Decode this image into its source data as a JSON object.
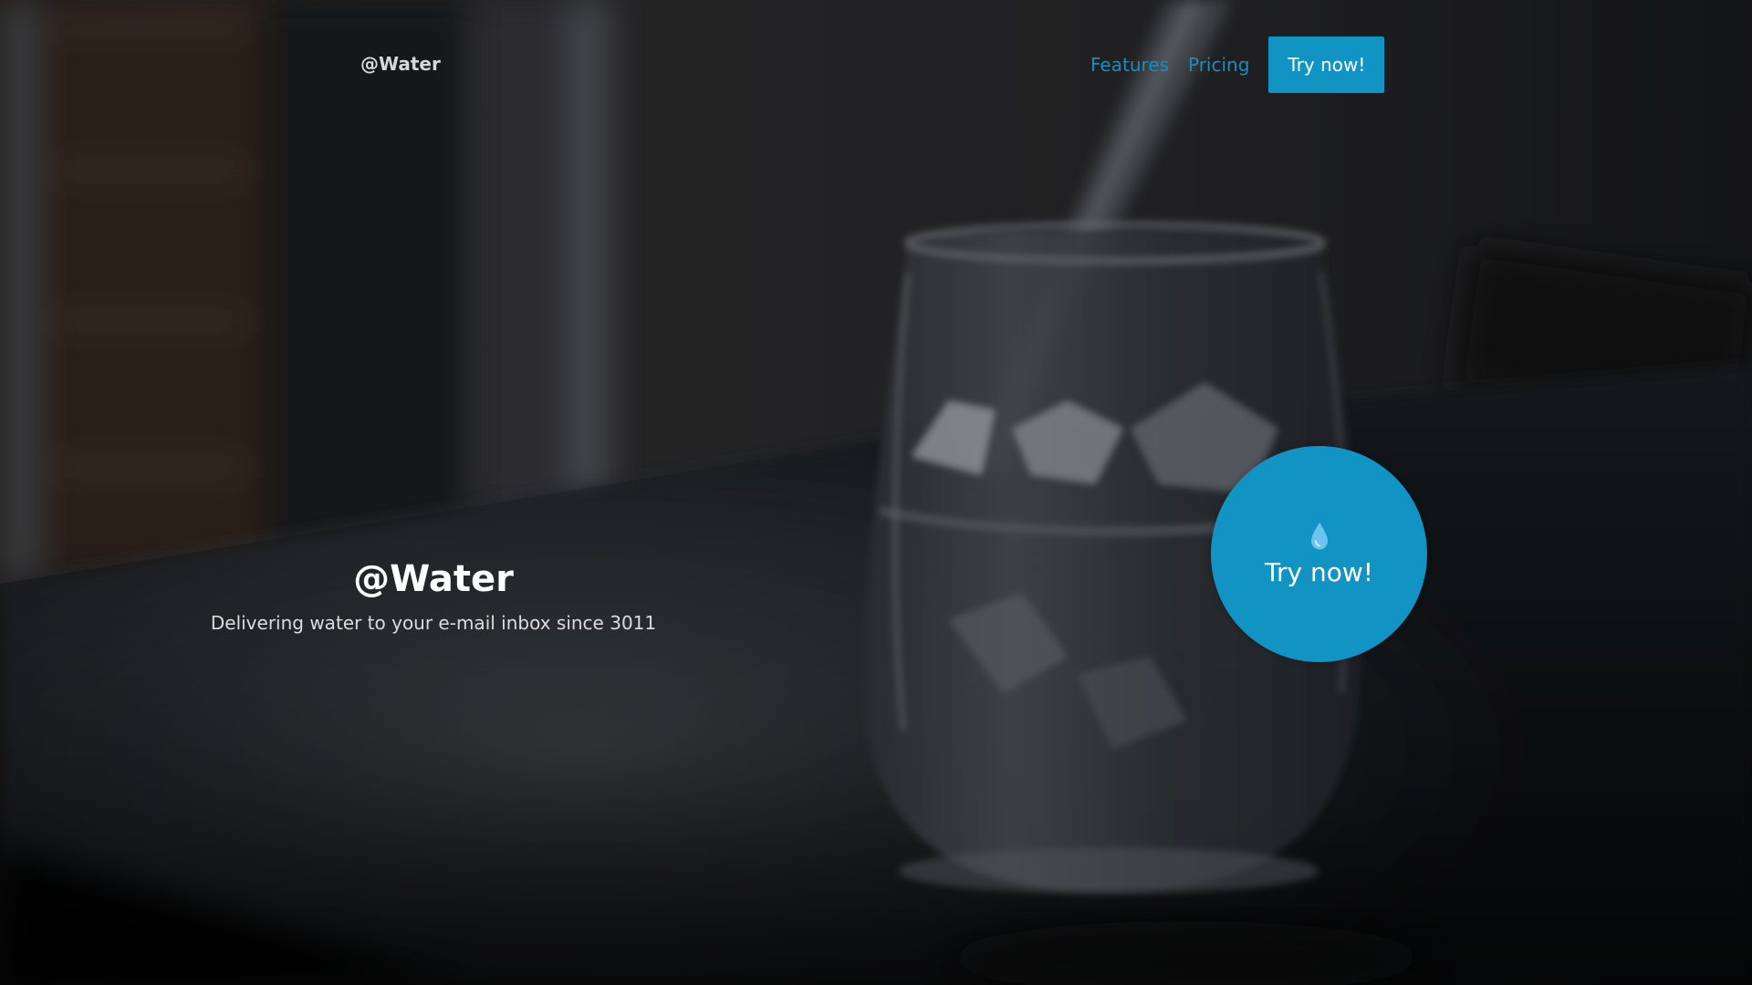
{
  "nav": {
    "logo": "@Water",
    "links": [
      {
        "label": "Features"
      },
      {
        "label": "Pricing"
      }
    ],
    "cta_label": "Try now!"
  },
  "hero": {
    "title": "@Water",
    "subtitle": "Delivering water to your e-mail inbox since 3011"
  },
  "round_cta": {
    "icon": "water-drop-icon",
    "label": "Try now!"
  },
  "colors": {
    "accent": "#1193c4",
    "link": "#1a8dc0",
    "background": "#2a2a2c"
  }
}
